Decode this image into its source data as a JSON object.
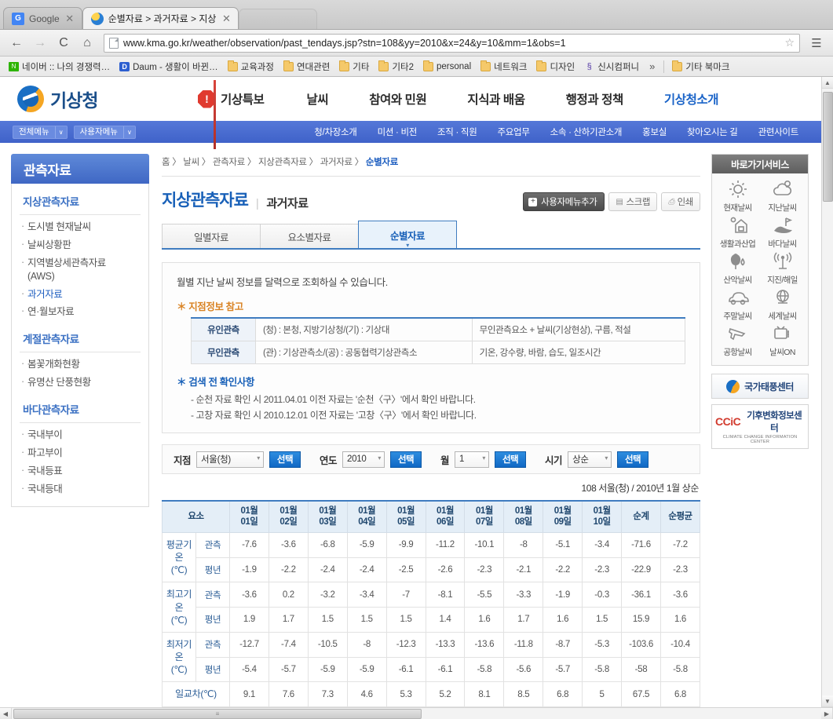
{
  "browser": {
    "tabs": [
      {
        "title": "Google",
        "favicon": "google-icon",
        "active": false
      },
      {
        "title": "순별자료 > 과거자료 > 지상",
        "favicon": "kma-icon",
        "active": true
      }
    ],
    "url": "www.kma.go.kr/weather/observation/past_tendays.jsp?stn=108&yy=2010&x=24&y=10&mm=1&obs=1",
    "bookmarks": [
      {
        "label": "네이버 :: 나의 경쟁력…",
        "icon": "naver-icon"
      },
      {
        "label": "Daum - 생활이 바뀐…",
        "icon": "daum-icon"
      },
      {
        "label": "교육과정",
        "icon": "folder-icon"
      },
      {
        "label": "연대관련",
        "icon": "folder-icon"
      },
      {
        "label": "기타",
        "icon": "folder-icon"
      },
      {
        "label": "기타2",
        "icon": "folder-icon"
      },
      {
        "label": "personal",
        "icon": "folder-icon"
      },
      {
        "label": "네트워크",
        "icon": "folder-icon"
      },
      {
        "label": "디자인",
        "icon": "folder-icon"
      },
      {
        "label": "신시컴퍼니",
        "icon": "shinsi-icon"
      }
    ],
    "bookmarks_overflow": "»",
    "other_bookmarks": {
      "label": "기타 북마크",
      "icon": "folder-icon"
    },
    "close_glyph": "✕"
  },
  "header": {
    "logo_text": "기상청",
    "alert_label": "기상특보",
    "nav": [
      {
        "label": "날씨",
        "current": false
      },
      {
        "label": "참여와 민원",
        "current": false
      },
      {
        "label": "지식과 배움",
        "current": false
      },
      {
        "label": "행정과 정책",
        "current": false
      },
      {
        "label": "기상청소개",
        "current": true
      }
    ],
    "menu_pills": [
      {
        "label": "전체메뉴",
        "caret": "∨"
      },
      {
        "label": "사용자메뉴",
        "caret": "∨"
      }
    ],
    "subnav": [
      "청/차장소개",
      "미션 · 비전",
      "조직 · 직원",
      "주요업무",
      "소속 · 산하기관소개",
      "홍보실",
      "찾아오시는 길",
      "관련사이트"
    ]
  },
  "sidebar": {
    "title": "관측자료",
    "groups": [
      {
        "name": "지상관측자료",
        "items": [
          {
            "label": "도시별 현재날씨",
            "active": false
          },
          {
            "label": "날씨상황판",
            "active": false
          },
          {
            "label": "지역별상세관측자료",
            "sub": "(AWS)",
            "active": false
          },
          {
            "label": "과거자료",
            "active": true
          },
          {
            "label": "연·월보자료",
            "active": false
          }
        ]
      },
      {
        "name": "계절관측자료",
        "items": [
          {
            "label": "봄꽃개화현황",
            "active": false
          },
          {
            "label": "유명산 단풍현황",
            "active": false
          }
        ]
      },
      {
        "name": "바다관측자료",
        "items": [
          {
            "label": "국내부이",
            "active": false
          },
          {
            "label": "파고부이",
            "active": false
          },
          {
            "label": "국내등표",
            "active": false
          },
          {
            "label": "국내등대",
            "active": false
          }
        ]
      }
    ]
  },
  "main": {
    "breadcrumb": {
      "items": [
        "홈",
        "날씨",
        "관측자료",
        "지상관측자료",
        "과거자료"
      ],
      "current": "순별자료",
      "separator": "〉"
    },
    "page_title": "지상관측자료",
    "page_subtitle": "과거자료",
    "actions": {
      "add_menu": "사용자메뉴추가",
      "scrap": "스크랩",
      "print": "인쇄"
    },
    "tabs": [
      {
        "label": "일별자료",
        "selected": false
      },
      {
        "label": "요소별자료",
        "selected": false
      },
      {
        "label": "순별자료",
        "selected": true
      }
    ],
    "info": {
      "lead": "월별 지난 날씨 정보를 달력으로 조회하실 수 있습니다.",
      "station_heading": "지점정보 참고",
      "station_rows": [
        {
          "kind": "유인관측",
          "desc": "(청) : 본청, 지방기상청/(기) : 기상대",
          "elements": "무인관측요소 + 날씨(기상현상), 구름, 적설"
        },
        {
          "kind": "무인관측",
          "desc": "(관) : 기상관측소/(공) : 공동협력기상관측소",
          "elements": "기온, 강수량, 바람, 습도, 일조시간"
        }
      ],
      "check_heading": "검색 전 확인사항",
      "notes": [
        "- 순천 자료 확인 시 2011.04.01 이전 자료는 '순천〈구〉'에서 확인 바랍니다.",
        "- 고창 자료 확인 시 2010.12.01 이전 자료는 '고창〈구〉'에서 확인 바랍니다."
      ]
    },
    "filters": [
      {
        "label": "지점",
        "value": "서울(청)",
        "button": "선택",
        "size": "site"
      },
      {
        "label": "연도",
        "value": "2010",
        "button": "선택",
        "size": "year"
      },
      {
        "label": "월",
        "value": "1",
        "button": "선택",
        "size": "month"
      },
      {
        "label": "시기",
        "value": "상순",
        "button": "선택",
        "size": "period"
      }
    ],
    "table_caption": "108 서울(청) / 2010년 1월 상순"
  },
  "chart_data": {
    "type": "table",
    "title": "108 서울(청) / 2010년 1월 상순",
    "element_header": "요소",
    "categories": [
      "01월\n01일",
      "01월\n02일",
      "01월\n03일",
      "01월\n04일",
      "01월\n05일",
      "01월\n06일",
      "01월\n07일",
      "01월\n08일",
      "01월\n09일",
      "01월\n10일"
    ],
    "day_labels_top": [
      "01월",
      "01월",
      "01월",
      "01월",
      "01월",
      "01월",
      "01월",
      "01월",
      "01월",
      "01월"
    ],
    "day_labels_bottom": [
      "01일",
      "02일",
      "03일",
      "04일",
      "05일",
      "06일",
      "07일",
      "08일",
      "09일",
      "10일"
    ],
    "summary_headers": [
      "순계",
      "순평균"
    ],
    "kinds": {
      "observed": "관측",
      "normal": "평년"
    },
    "rows": [
      {
        "element": "평균기온",
        "unit": "(℃)",
        "series": [
          {
            "name": "관측",
            "values": [
              -7.6,
              -3.6,
              -6.8,
              -5.9,
              -9.9,
              -11.2,
              -10.1,
              -8.0,
              -5.1,
              -3.4
            ],
            "sum": -71.6,
            "mean": -7.2
          },
          {
            "name": "평년",
            "values": [
              -1.9,
              -2.2,
              -2.4,
              -2.4,
              -2.5,
              -2.6,
              -2.3,
              -2.1,
              -2.2,
              -2.3
            ],
            "sum": -22.9,
            "mean": -2.3
          }
        ]
      },
      {
        "element": "최고기온",
        "unit": "(℃)",
        "series": [
          {
            "name": "관측",
            "values": [
              -3.6,
              0.2,
              -3.2,
              -3.4,
              -7.0,
              -8.1,
              -5.5,
              -3.3,
              -1.9,
              -0.3
            ],
            "sum": -36.1,
            "mean": -3.6
          },
          {
            "name": "평년",
            "values": [
              1.9,
              1.7,
              1.5,
              1.5,
              1.5,
              1.4,
              1.6,
              1.7,
              1.6,
              1.5
            ],
            "sum": 15.9,
            "mean": 1.6
          }
        ]
      },
      {
        "element": "최저기온",
        "unit": "(℃)",
        "series": [
          {
            "name": "관측",
            "values": [
              -12.7,
              -7.4,
              -10.5,
              -8.0,
              -12.3,
              -13.3,
              -13.6,
              -11.8,
              -8.7,
              -5.3
            ],
            "sum": -103.6,
            "mean": -10.4
          },
          {
            "name": "평년",
            "values": [
              -5.4,
              -5.7,
              -5.9,
              -5.9,
              -6.1,
              -6.1,
              -5.8,
              -5.6,
              -5.7,
              -5.8
            ],
            "sum": -58.0,
            "mean": -5.8
          }
        ]
      },
      {
        "element": "일교차(℃)",
        "unit": "",
        "partial": true,
        "series": [
          {
            "name": "",
            "values": [
              9.1,
              7.6,
              7.3,
              4.6,
              5.3,
              5.2,
              8.1,
              8.5,
              6.8,
              5.0
            ],
            "sum": 67.5,
            "mean": 6.8
          }
        ]
      }
    ]
  },
  "right_rail": {
    "title": "바로가기서비스",
    "shortcuts": [
      {
        "label": "현재날씨",
        "icon": "sun-icon"
      },
      {
        "label": "지난날씨",
        "icon": "cloud-icon"
      },
      {
        "label": "생활과산업",
        "icon": "house-sun-icon"
      },
      {
        "label": "바다날씨",
        "icon": "island-flag-icon"
      },
      {
        "label": "산악날씨",
        "icon": "tree-icon"
      },
      {
        "label": "지진/해일",
        "icon": "seismic-antenna-icon"
      },
      {
        "label": "주말날씨",
        "icon": "car-icon"
      },
      {
        "label": "세계날씨",
        "icon": "globe-icon"
      },
      {
        "label": "공항날씨",
        "icon": "airplane-icon"
      },
      {
        "label": "날씨ON",
        "icon": "tv-icon"
      }
    ],
    "banners": [
      {
        "label": "국가태풍센터",
        "icon": "kma-logo-icon",
        "sub": ""
      },
      {
        "label": "기후변화정보센터",
        "icon": "ccic-icon",
        "prefix": "CCiC",
        "sub": "CLIMATE CHANGE INFORMATION CENTER"
      }
    ]
  }
}
